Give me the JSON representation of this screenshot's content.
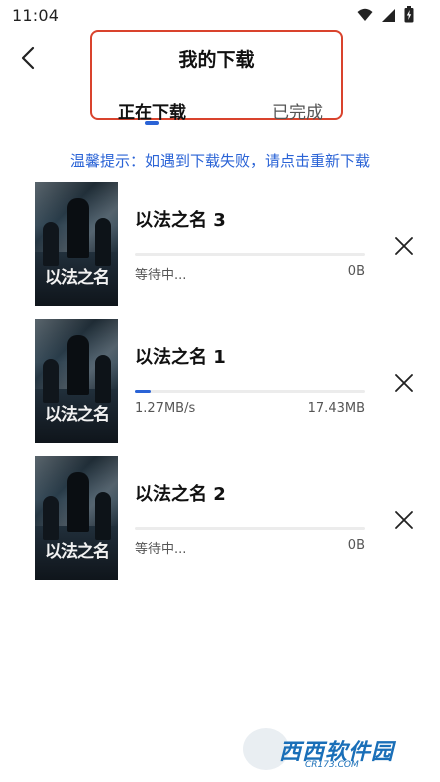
{
  "status_bar": {
    "time": "11:04",
    "icons": [
      "wifi-icon",
      "signal-icon",
      "battery-charging-icon"
    ]
  },
  "header": {
    "title": "我的下载",
    "tabs": [
      {
        "label": "正在下载",
        "active": true
      },
      {
        "label": "已完成",
        "active": false
      }
    ]
  },
  "notice": "温馨提示：如遇到下载失败，请点击重新下载",
  "downloads": [
    {
      "title": "以法之名 3",
      "status": "等待中...",
      "size": "0B",
      "progress": 0.0
    },
    {
      "title": "以法之名 1",
      "status": "1.27MB/s",
      "size": "17.43MB",
      "progress": 0.07
    },
    {
      "title": "以法之名 2",
      "status": "等待中...",
      "size": "0B",
      "progress": 0.0
    }
  ],
  "poster_title": "以法之名",
  "watermark": {
    "brand": "西西软件园",
    "url": "CR173.COM"
  },
  "colors": {
    "accent": "#2a63d6",
    "highlight_border": "#d9432d"
  }
}
